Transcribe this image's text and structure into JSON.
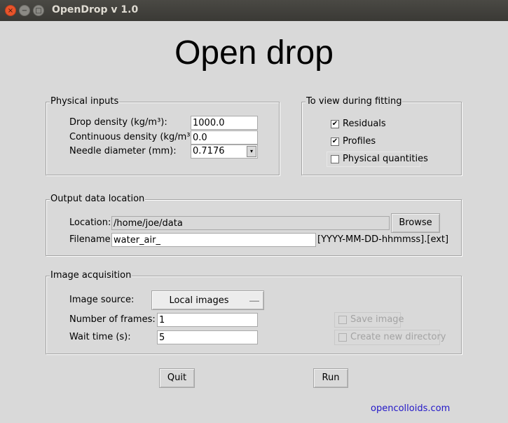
{
  "window": {
    "title": "OpenDrop v 1.0",
    "close": "×",
    "minimize": "−",
    "maximize": "□"
  },
  "heading": "Open drop",
  "physical_inputs": {
    "title": "Physical inputs",
    "drop_density_label": "Drop density (kg/m³):",
    "drop_density_value": "1000.0",
    "continuous_density_label": "Continuous density (kg/m³):",
    "continuous_density_value": "0.0",
    "needle_diameter_label": "Needle diameter (mm):",
    "needle_diameter_value": "0.7176",
    "combo_arrow": "▾"
  },
  "view_fitting": {
    "title": "To view during fitting",
    "items": [
      {
        "label": "Residuals",
        "checked": true,
        "mark": "✔"
      },
      {
        "label": "Profiles",
        "checked": true,
        "mark": "✔"
      },
      {
        "label": "Physical quantities",
        "checked": false,
        "mark": ""
      }
    ]
  },
  "output": {
    "title": "Output data location",
    "location_label": "Location:",
    "location_value": "/home/joe/data",
    "browse_label": "Browse",
    "filename_label": "Filename:",
    "filename_value": "water_air_",
    "filename_suffix": "[YYYY-MM-DD-hhmmss].[ext]"
  },
  "acquisition": {
    "title": "Image acquisition",
    "source_label": "Image source:",
    "source_value": "Local images",
    "frames_label": "Number of frames:",
    "frames_value": "1",
    "wait_label": "Wait time (s):",
    "wait_value": "5",
    "save_image_label": "Save image",
    "create_dir_label": "Create new directory"
  },
  "actions": {
    "quit_label": "Quit",
    "run_label": "Run"
  },
  "footer_link": "opencolloids.com"
}
